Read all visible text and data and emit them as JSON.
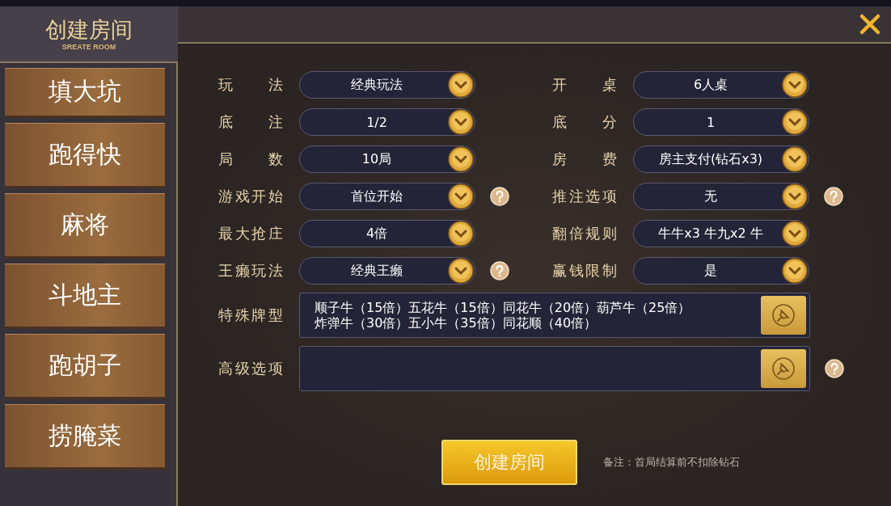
{
  "header": {
    "title": "创建房间",
    "subtitle": "SREATE ROOM"
  },
  "game_tabs": [
    {
      "label": "填大坑"
    },
    {
      "label": "跑得快"
    },
    {
      "label": "麻将"
    },
    {
      "label": "斗地主"
    },
    {
      "label": "跑胡子"
    },
    {
      "label": "捞腌菜"
    }
  ],
  "settings": [
    {
      "label": "玩法",
      "value": "经典玩法",
      "help": false
    },
    {
      "label": "开桌",
      "value": "6人桌",
      "help": false
    },
    {
      "label": "底注",
      "value": "1/2",
      "help": false
    },
    {
      "label": "底分",
      "value": "1",
      "help": false
    },
    {
      "label": "局数",
      "value": "10局",
      "help": false
    },
    {
      "label": "房费",
      "value": "房主支付(钻石x3)",
      "help": false
    },
    {
      "label": "游戏开始",
      "value": "首位开始",
      "help": true
    },
    {
      "label": "推注选项",
      "value": "无",
      "help": true
    },
    {
      "label": "最大抢庄",
      "value": "4倍",
      "help": false
    },
    {
      "label": "翻倍规则",
      "value": "牛牛x3 牛九x2 牛",
      "help": false
    },
    {
      "label": "王癞玩法",
      "value": "经典王癞",
      "help": true
    },
    {
      "label": "赢钱限制",
      "value": "是",
      "help": false
    }
  ],
  "options": [
    {
      "label": "特殊牌型",
      "lines": [
        "顺子牛（15倍）五花牛（15倍）同花牛（20倍）葫芦牛（25倍）",
        "炸弹牛（30倍）五小牛（35倍）同花顺（40倍）"
      ],
      "help": false
    },
    {
      "label": "高级选项",
      "help": true
    }
  ],
  "create_button": "创建房间",
  "note": "备注：首局结算前不扣除钻石"
}
